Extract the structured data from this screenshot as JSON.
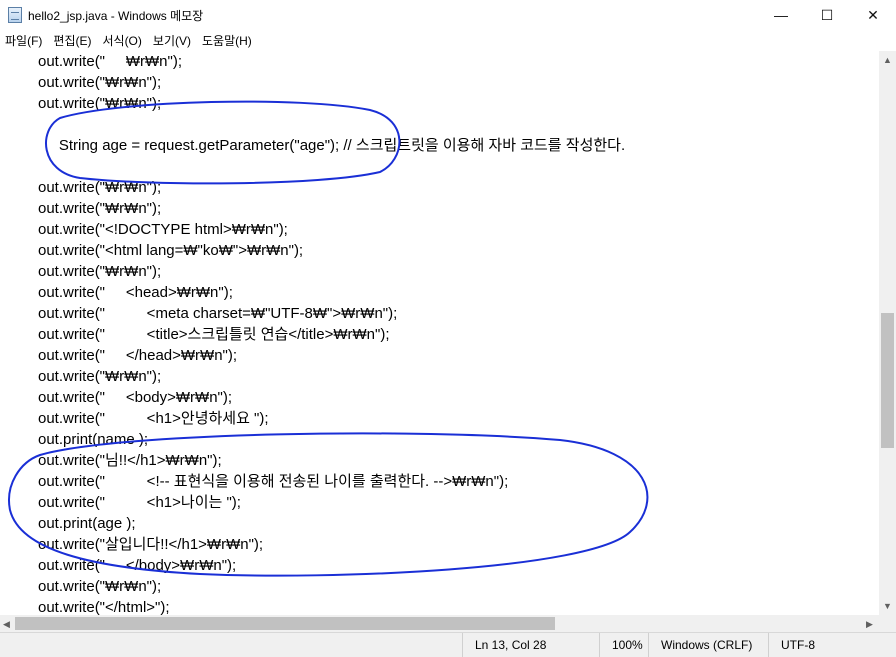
{
  "window": {
    "title": "hello2_jsp.java - Windows 메모장",
    "controls": {
      "minimize": "—",
      "maximize": "☐",
      "close": "✕"
    }
  },
  "menu": [
    "파일(F)",
    "편집(E)",
    "서식(O)",
    "보기(V)",
    "도움말(H)"
  ],
  "code_lines": [
    "out.write(\"     ₩r₩n\");",
    "out.write(\"₩r₩n\");",
    "out.write(\"₩r₩n\");",
    "",
    "     String age = request.getParameter(\"age\"); // 스크립트릿을 이용해 자바 코드를 작성한다.",
    "",
    "out.write(\"₩r₩n\");",
    "out.write(\"₩r₩n\");",
    "out.write(\"<!DOCTYPE html>₩r₩n\");",
    "out.write(\"<html lang=₩\"ko₩\">₩r₩n\");",
    "out.write(\"₩r₩n\");",
    "out.write(\"     <head>₩r₩n\");",
    "out.write(\"          <meta charset=₩\"UTF-8₩\">₩r₩n\");",
    "out.write(\"          <title>스크립틀릿 연습</title>₩r₩n\");",
    "out.write(\"     </head>₩r₩n\");",
    "out.write(\"₩r₩n\");",
    "out.write(\"     <body>₩r₩n\");",
    "out.write(\"          <h1>안녕하세요 \");",
    "out.print(name );",
    "out.write(\"님!!</h1>₩r₩n\");",
    "out.write(\"          <!-- 표현식을 이용해 전송된 나이를 출력한다. -->₩r₩n\");",
    "out.write(\"          <h1>나이는 \");",
    "out.print(age );",
    "out.write(\"살입니다!!</h1>₩r₩n\");",
    "out.write(\"     </body>₩r₩n\");",
    "out.write(\"₩r₩n\");",
    "out.write(\"</html>\");"
  ],
  "status": {
    "position": "Ln 13, Col 28",
    "zoom": "100%",
    "line_ending": "Windows (CRLF)",
    "encoding": "UTF-8"
  },
  "scroll": {
    "vertical_fraction": 0.62,
    "horizontal_fraction": 0.0
  },
  "colors": {
    "annotation": "#1a2fd6",
    "status_bg": "#f0f0f0"
  }
}
